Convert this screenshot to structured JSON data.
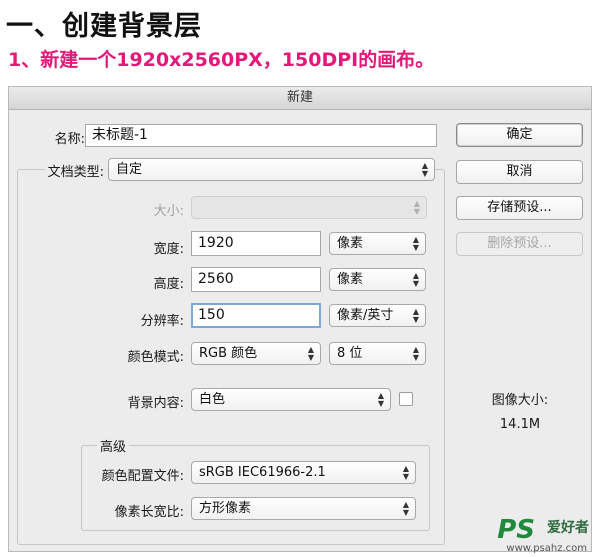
{
  "heading": "一、创建背景层",
  "subheading": "1、新建一个1920x2560PX，150DPI的画布。",
  "dialog": {
    "title": "新建",
    "name_label": "名称:",
    "name_value": "未标题-1",
    "doc_type_label": "文档类型:",
    "doc_type_value": "自定",
    "size_label": "大小:",
    "size_value": "",
    "width_label": "宽度:",
    "width_value": "1920",
    "width_unit": "像素",
    "height_label": "高度:",
    "height_value": "2560",
    "height_unit": "像素",
    "resolution_label": "分辨率:",
    "resolution_value": "150",
    "resolution_unit": "像素/英寸",
    "color_mode_label": "颜色模式:",
    "color_mode_value": "RGB 颜色",
    "bit_depth_value": "8 位",
    "background_label": "背景内容:",
    "background_value": "白色",
    "advanced_label": "高级",
    "color_profile_label": "颜色配置文件:",
    "color_profile_value": "sRGB IEC61966-2.1",
    "pixel_aspect_label": "像素长宽比:",
    "pixel_aspect_value": "方形像素",
    "buttons": {
      "ok": "确定",
      "cancel": "取消",
      "save_preset": "存储预设...",
      "delete_preset": "删除预设..."
    },
    "image_size_label": "图像大小:",
    "image_size_value": "14.1M"
  },
  "watermark": {
    "logo": "PS",
    "text": "爱好者",
    "url": "www.psahz.com"
  },
  "colors": {
    "accent": "#e3197a",
    "dialog_bg": "#ececec",
    "focus_ring": "#7aa7de"
  }
}
